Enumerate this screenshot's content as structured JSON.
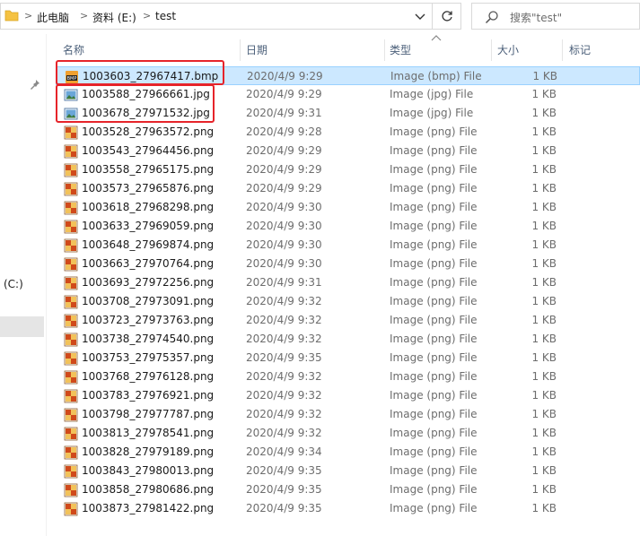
{
  "address": {
    "crumbs": [
      "此电脑",
      "资料 (E:)",
      "test"
    ]
  },
  "search": {
    "placeholder": "搜索\"test\""
  },
  "nav": {
    "drive_label": "(C:)"
  },
  "columns": {
    "name": "名称",
    "date": "日期",
    "type": "类型",
    "size": "大小",
    "tags": "标记"
  },
  "files": [
    {
      "name": "1003603_27967417.bmp",
      "date": "2020/4/9 9:29",
      "type": "Image (bmp) File",
      "size": "1 KB",
      "kind": "bmp",
      "selected": true
    },
    {
      "name": "1003588_27966661.jpg",
      "date": "2020/4/9 9:29",
      "type": "Image (jpg) File",
      "size": "1 KB",
      "kind": "jpg"
    },
    {
      "name": "1003678_27971532.jpg",
      "date": "2020/4/9 9:31",
      "type": "Image (jpg) File",
      "size": "1 KB",
      "kind": "jpg"
    },
    {
      "name": "1003528_27963572.png",
      "date": "2020/4/9 9:28",
      "type": "Image (png) File",
      "size": "1 KB",
      "kind": "png"
    },
    {
      "name": "1003543_27964456.png",
      "date": "2020/4/9 9:29",
      "type": "Image (png) File",
      "size": "1 KB",
      "kind": "png"
    },
    {
      "name": "1003558_27965175.png",
      "date": "2020/4/9 9:29",
      "type": "Image (png) File",
      "size": "1 KB",
      "kind": "png"
    },
    {
      "name": "1003573_27965876.png",
      "date": "2020/4/9 9:29",
      "type": "Image (png) File",
      "size": "1 KB",
      "kind": "png"
    },
    {
      "name": "1003618_27968298.png",
      "date": "2020/4/9 9:30",
      "type": "Image (png) File",
      "size": "1 KB",
      "kind": "png"
    },
    {
      "name": "1003633_27969059.png",
      "date": "2020/4/9 9:30",
      "type": "Image (png) File",
      "size": "1 KB",
      "kind": "png"
    },
    {
      "name": "1003648_27969874.png",
      "date": "2020/4/9 9:30",
      "type": "Image (png) File",
      "size": "1 KB",
      "kind": "png"
    },
    {
      "name": "1003663_27970764.png",
      "date": "2020/4/9 9:30",
      "type": "Image (png) File",
      "size": "1 KB",
      "kind": "png"
    },
    {
      "name": "1003693_27972256.png",
      "date": "2020/4/9 9:31",
      "type": "Image (png) File",
      "size": "1 KB",
      "kind": "png"
    },
    {
      "name": "1003708_27973091.png",
      "date": "2020/4/9 9:32",
      "type": "Image (png) File",
      "size": "1 KB",
      "kind": "png"
    },
    {
      "name": "1003723_27973763.png",
      "date": "2020/4/9 9:32",
      "type": "Image (png) File",
      "size": "1 KB",
      "kind": "png"
    },
    {
      "name": "1003738_27974540.png",
      "date": "2020/4/9 9:32",
      "type": "Image (png) File",
      "size": "1 KB",
      "kind": "png"
    },
    {
      "name": "1003753_27975357.png",
      "date": "2020/4/9 9:35",
      "type": "Image (png) File",
      "size": "1 KB",
      "kind": "png"
    },
    {
      "name": "1003768_27976128.png",
      "date": "2020/4/9 9:32",
      "type": "Image (png) File",
      "size": "1 KB",
      "kind": "png"
    },
    {
      "name": "1003783_27976921.png",
      "date": "2020/4/9 9:32",
      "type": "Image (png) File",
      "size": "1 KB",
      "kind": "png"
    },
    {
      "name": "1003798_27977787.png",
      "date": "2020/4/9 9:32",
      "type": "Image (png) File",
      "size": "1 KB",
      "kind": "png"
    },
    {
      "name": "1003813_27978541.png",
      "date": "2020/4/9 9:32",
      "type": "Image (png) File",
      "size": "1 KB",
      "kind": "png"
    },
    {
      "name": "1003828_27979189.png",
      "date": "2020/4/9 9:34",
      "type": "Image (png) File",
      "size": "1 KB",
      "kind": "png"
    },
    {
      "name": "1003843_27980013.png",
      "date": "2020/4/9 9:35",
      "type": "Image (png) File",
      "size": "1 KB",
      "kind": "png"
    },
    {
      "name": "1003858_27980686.png",
      "date": "2020/4/9 9:35",
      "type": "Image (png) File",
      "size": "1 KB",
      "kind": "png"
    },
    {
      "name": "1003873_27981422.png",
      "date": "2020/4/9 9:35",
      "type": "Image (png) File",
      "size": "1 KB",
      "kind": "png"
    }
  ],
  "colors": {
    "selection_bg": "#cce8ff",
    "selection_border": "#99d1ff",
    "header_text": "#4c607a",
    "annotation_red": "#e6242a",
    "folder_yellow": "#f5c242"
  }
}
